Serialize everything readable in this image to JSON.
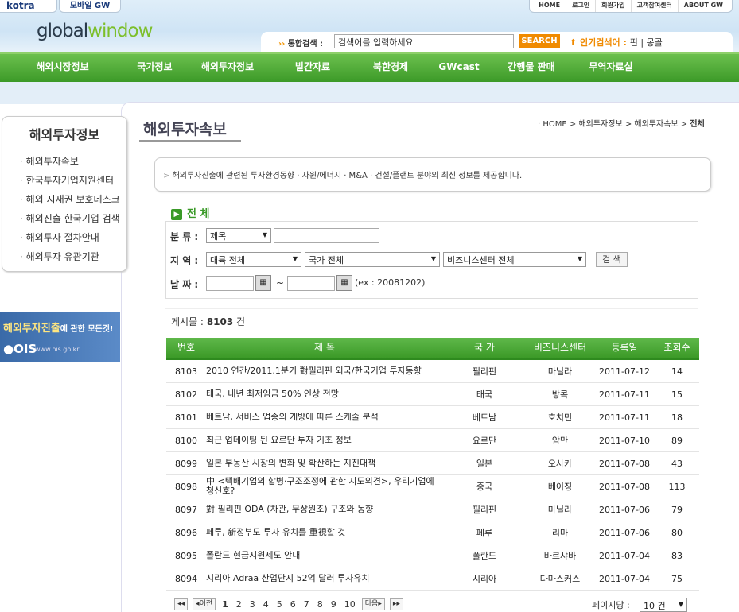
{
  "header": {
    "kotra": "kotra",
    "mobile": "모바일 GW",
    "toplinks": [
      "HOME",
      "로그인",
      "회원가입",
      "고객참여센터",
      "ABOUT GW"
    ],
    "logo_a": "global",
    "logo_b": "window",
    "search_label": "통합검색 :",
    "search_placeholder": "검색어를 입력하세요",
    "search_button": "SEARCH",
    "popular_label": "인기검색어 :",
    "popular_terms": "핀 | 몽골"
  },
  "nav": [
    "해외시장정보",
    "국가정보",
    "해외투자정보",
    "빌간자료",
    "북한경제",
    "GWcast",
    "간행물 판매",
    "무역자료실"
  ],
  "sidebar": {
    "title": "해외투자정보",
    "items": [
      "해외투자속보",
      "한국투자기업지원센터",
      "해외 지재권 보호데스크",
      "해외진출 한국기업 검색",
      "해외투자 절차안내",
      "해외투자 유관기관"
    ],
    "banner_a": "해외투자진출",
    "banner_b": "에 관한 모든것!",
    "banner_c": "OIS",
    "banner_d": "www.ois.go.kr"
  },
  "page": {
    "title": "해외투자속보",
    "breadcrumb": [
      "· HOME",
      "해외투자정보",
      "해외투자속보",
      "전체"
    ],
    "info": "해외투자진출에 관련된 투자환경동향 · 자원/에너지 · M&A · 건설/플랜트 분야의 최신 정보를 제공합니다.",
    "section": "전 체"
  },
  "filter": {
    "cat_label": "분 류 :",
    "cat_value": "제목",
    "region_label": "지 역 :",
    "region1": "대륙 전체",
    "region2": "국가 전체",
    "region3": "비즈니스센터 전체",
    "search_btn": "검 색",
    "date_label": "날 짜 :",
    "date_sep": "~",
    "date_hint": "(ex : 20081202)"
  },
  "count": {
    "label": "게시물 :",
    "value": "8103",
    "unit": "건"
  },
  "table": {
    "headers": [
      "번호",
      "제 목",
      "국 가",
      "비즈니스센터",
      "등록일",
      "조회수"
    ],
    "rows": [
      [
        "8103",
        "2010 연간/2011.1분기 對필리핀 외국/한국기업 투자동향",
        "필리핀",
        "마닐라",
        "2011-07-12",
        "14"
      ],
      [
        "8102",
        "태국, 내년 최저임금 50% 인상 전망",
        "태국",
        "방콕",
        "2011-07-11",
        "15"
      ],
      [
        "8101",
        "베트남, 서비스 업종의 개방에 따른 스케줄 분석",
        "베트남",
        "호치민",
        "2011-07-11",
        "18"
      ],
      [
        "8100",
        "최근 업데이팅 된 요르단 투자 기초 정보",
        "요르단",
        "암만",
        "2011-07-10",
        "89"
      ],
      [
        "8099",
        "일본 부동산 시장의 변화 및 확산하는 지진대책",
        "일본",
        "오사카",
        "2011-07-08",
        "43"
      ],
      [
        "8098",
        "中 <택배기업의 합병·구조조정에 관한 지도의견>, 우리기업에 청신호?",
        "중국",
        "베이징",
        "2011-07-08",
        "113"
      ],
      [
        "8097",
        "對 필리핀 ODA (차관, 무상원조) 구조와 동향",
        "필리핀",
        "마닐라",
        "2011-07-06",
        "79"
      ],
      [
        "8096",
        "페루, 新정부도 투자 유치를 重視할 것",
        "페루",
        "리마",
        "2011-07-06",
        "80"
      ],
      [
        "8095",
        "폴란드 현금지원제도 안내",
        "폴란드",
        "바르샤바",
        "2011-07-04",
        "83"
      ],
      [
        "8094",
        "시리아 Adraa 산업단지 52억 달러 투자유치",
        "시리아",
        "다마스커스",
        "2011-07-04",
        "75"
      ]
    ]
  },
  "pager": {
    "first": "◂◂",
    "prev": "◂이전",
    "pages": [
      "1",
      "2",
      "3",
      "4",
      "5",
      "6",
      "7",
      "8",
      "9",
      "10"
    ],
    "next": "다음▸",
    "last": "▸▸",
    "perpage_label": "페이지당 :",
    "perpage_value": "10 건"
  }
}
